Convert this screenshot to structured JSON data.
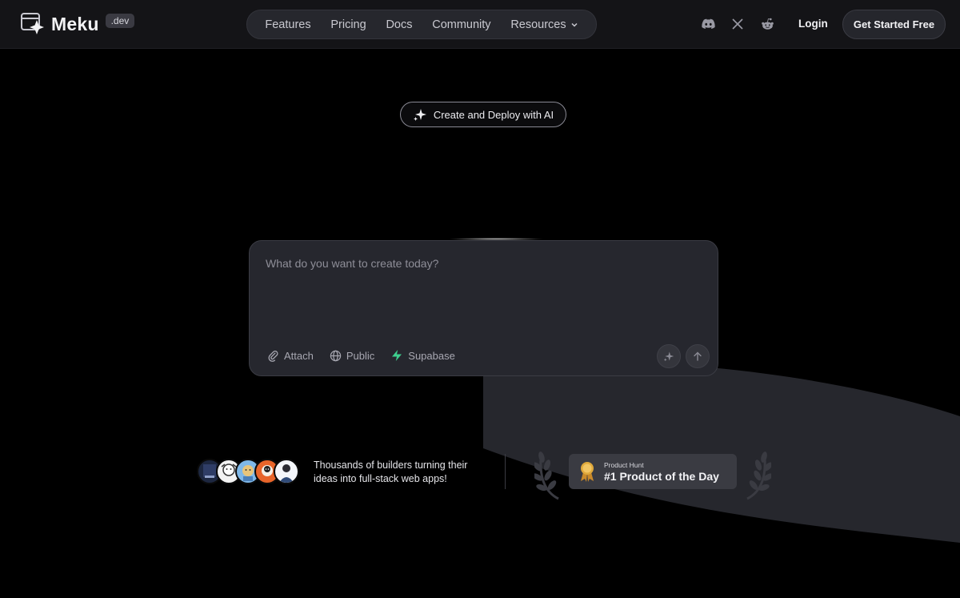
{
  "brand": {
    "name": "Meku",
    "badge": ".dev"
  },
  "nav": {
    "items": [
      {
        "label": "Features"
      },
      {
        "label": "Pricing"
      },
      {
        "label": "Docs"
      },
      {
        "label": "Community"
      },
      {
        "label": "Resources",
        "has_dropdown": true
      }
    ]
  },
  "header": {
    "social_icons": [
      "discord-icon",
      "x-icon",
      "reddit-icon"
    ],
    "login_label": "Login",
    "cta_label": "Get Started Free"
  },
  "hero": {
    "pill_label": "Create and Deploy with AI"
  },
  "prompt": {
    "placeholder": "What do you want to create today?",
    "value": "",
    "tools": [
      {
        "label": "Attach",
        "icon": "paperclip-icon"
      },
      {
        "label": "Public",
        "icon": "globe-icon"
      },
      {
        "label": "Supabase",
        "icon": "supabase-icon"
      }
    ]
  },
  "social_proof": {
    "text": "Thousands of builders turning their ideas into full-stack web apps!"
  },
  "product_hunt": {
    "small_label": "Product Hunt",
    "title": "#1 Product of the Day"
  },
  "colors": {
    "background": "#000000",
    "header": "#141417",
    "card": "#26272e",
    "accent_green": "#3ecf8e",
    "medal_gold": "#e0a93b"
  }
}
